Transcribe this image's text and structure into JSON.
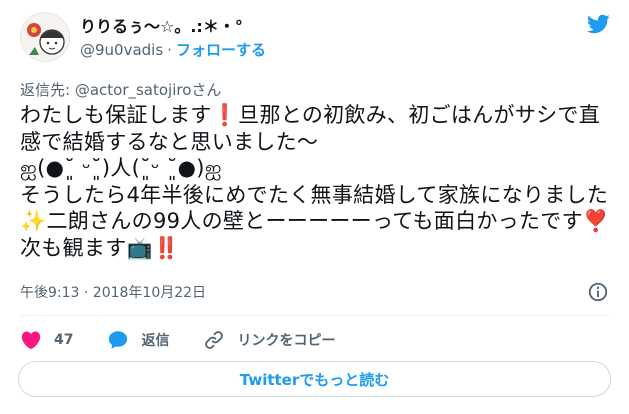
{
  "author": {
    "display_name": "りりるぅ〜☆。.:＊・°",
    "handle": "@9u0vadis",
    "separator": "·",
    "follow_label": "フォローする"
  },
  "tweet": {
    "reply_to": "返信先: @actor_satojiroさん",
    "text": "わたしも保証します❗旦那との初飲み、初ごはんがサシで直感で結婚するなと思いました〜\nஐ(●˘͈ ᵕ˘͈)人(˘͈ᵕ ˘͈●)ஐ\nそうしたら4年半後にめでたく無事結婚して家族になりました✨二朗さんの99人の壁とーーーーーっても面白かったです❣️次も観ます📺‼️",
    "timestamp": "午後9:13 · 2018年10月22日"
  },
  "actions": {
    "likes_count": "47",
    "reply_label": "返信",
    "copy_link_label": "リンクをコピー"
  },
  "footer": {
    "read_more_label": "Twitterでもっと読む"
  },
  "icons": [
    "heart-icon",
    "reply-bubble-icon",
    "link-icon",
    "info-icon",
    "twitter-bird-icon"
  ],
  "colors": {
    "accent": "#1d9bf0",
    "like": "#f91880",
    "secondary_text": "#536471"
  }
}
